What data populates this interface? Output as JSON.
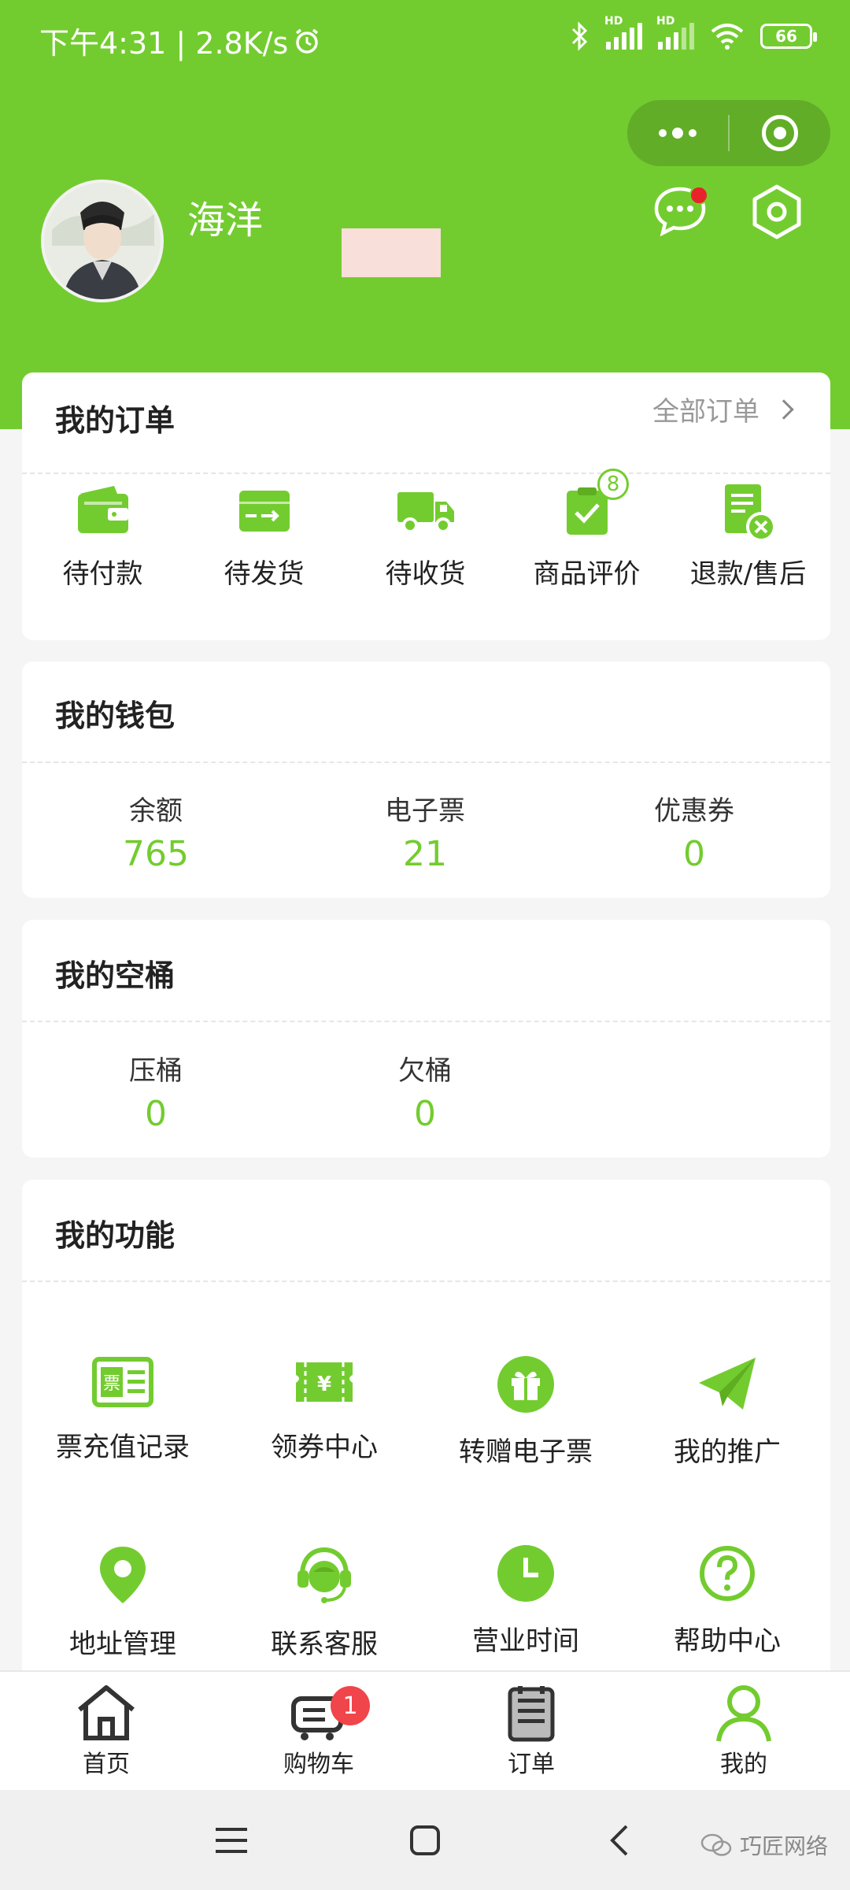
{
  "status_bar": {
    "time_speed": "下午4:31 | 2.8K/s",
    "battery": "66",
    "hd": "HD"
  },
  "capsule": {
    "more_icon": "more-dots-icon",
    "close_icon": "target-close-icon"
  },
  "profile": {
    "username": "海洋"
  },
  "header": {
    "accent_color": "#73cc2f",
    "badge_color": "#e8222a"
  },
  "orders": {
    "title": "我的订单",
    "all_link": "全部订单",
    "items": [
      {
        "label": "待付款",
        "icon": "wallet-icon"
      },
      {
        "label": "待发货",
        "icon": "package-icon"
      },
      {
        "label": "待收货",
        "icon": "truck-icon"
      },
      {
        "label": "商品评价",
        "icon": "review-clipboard-icon",
        "badge": "8"
      },
      {
        "label": "退款/售后",
        "icon": "refund-doc-icon"
      }
    ]
  },
  "wallet": {
    "title": "我的钱包",
    "items": [
      {
        "label": "余额",
        "value": "765"
      },
      {
        "label": "电子票",
        "value": "21"
      },
      {
        "label": "优惠券",
        "value": "0"
      }
    ]
  },
  "buckets": {
    "title": "我的空桶",
    "items": [
      {
        "label": "压桶",
        "value": "0"
      },
      {
        "label": "欠桶",
        "value": "0"
      }
    ]
  },
  "functions": {
    "title": "我的功能",
    "items": [
      {
        "label": "票充值记录",
        "icon": "ticket-record-icon"
      },
      {
        "label": "领券中心",
        "icon": "coupon-icon"
      },
      {
        "label": "转赠电子票",
        "icon": "gift-icon"
      },
      {
        "label": "我的推广",
        "icon": "paper-plane-icon"
      },
      {
        "label": "地址管理",
        "icon": "location-pin-icon"
      },
      {
        "label": "联系客服",
        "icon": "customer-service-icon"
      },
      {
        "label": "营业时间",
        "icon": "clock-icon"
      },
      {
        "label": "帮助中心",
        "icon": "help-icon"
      }
    ]
  },
  "tabbar": {
    "items": [
      {
        "label": "首页",
        "icon": "home-icon"
      },
      {
        "label": "购物车",
        "icon": "cart-icon",
        "badge": "1"
      },
      {
        "label": "订单",
        "icon": "order-list-icon"
      },
      {
        "label": "我的",
        "icon": "profile-icon"
      }
    ]
  },
  "watermark": "巧匠网络"
}
